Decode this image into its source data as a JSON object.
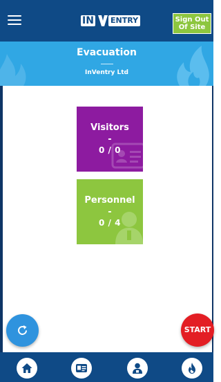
{
  "header": {
    "logo": {
      "part1": "IN",
      "part2": "V",
      "part3": "ENTRY"
    },
    "signout_line1": "Sign Out",
    "signout_line2": "Of Site"
  },
  "banner": {
    "title": "Evacuation",
    "subtitle": "InVentry Ltd"
  },
  "tiles": {
    "visitors": {
      "label": "Visitors",
      "dash": "-",
      "count": "0 / 0"
    },
    "personnel": {
      "label": "Personnel",
      "dash": "-",
      "count": "0 / 4"
    }
  },
  "actions": {
    "start_label": "START"
  },
  "colors": {
    "header_bg": "#0f4a86",
    "banner_bg": "#30a7e4",
    "visitors_tile": "#8d1ba0",
    "personnel_tile": "#8dc63f",
    "signout_bg": "#8dc63f",
    "refresh_button": "#2f93de",
    "start_button": "#e31e24"
  },
  "icons": {
    "menu": "hamburger-menu-icon",
    "refresh": "refresh-icon",
    "nav": [
      "home-icon",
      "id-card-icon",
      "person-badge-icon",
      "flame-icon"
    ]
  }
}
